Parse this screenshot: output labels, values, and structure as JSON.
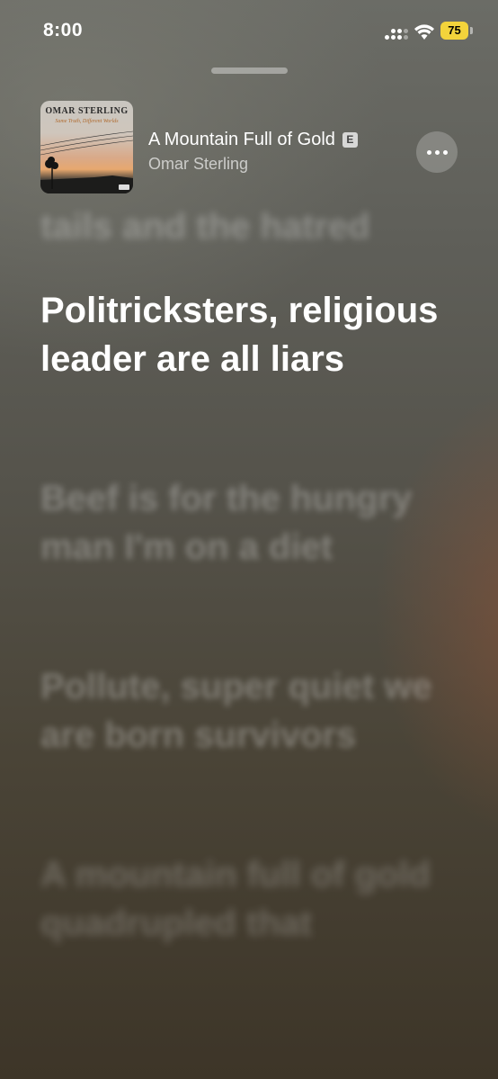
{
  "status_bar": {
    "time": "8:00",
    "battery": "75"
  },
  "now_playing": {
    "title": "A Mountain Full of Gold",
    "explicit_badge": "E",
    "artist": "Omar Sterling",
    "artwork": {
      "title": "Omar Sterling",
      "subtitle": "Same Truth, Different Worlds"
    }
  },
  "lyrics": {
    "previous": "tails and the hatred",
    "current": "Politricksters, religious leader are all liars",
    "upcoming": [
      "Beef is for the hungry man I'm on a diet",
      "Pollute, super quiet we are born survivors",
      "A mountain full of gold quadrupled that"
    ]
  },
  "icons": {
    "signal": "cellular-signal-icon",
    "wifi": "wifi-icon",
    "battery": "battery-icon",
    "more": "ellipsis-icon"
  },
  "colors": {
    "battery_fill": "#f3d33b",
    "text_primary": "#ffffff"
  }
}
